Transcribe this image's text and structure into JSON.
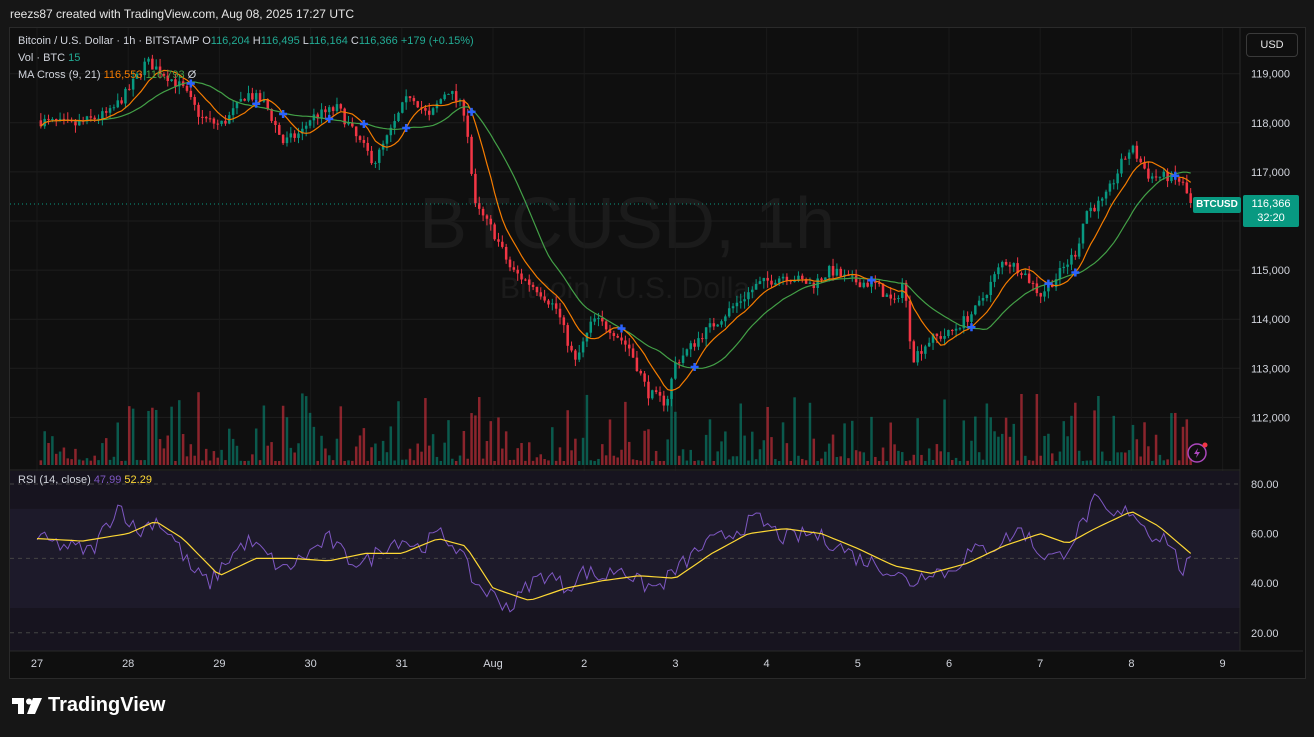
{
  "caption": "reezs87 created with TradingView.com, Aug 08, 2025 17:27 UTC",
  "legend": {
    "symbol_line": "Bitcoin / U.S. Dollar · 1h · BITSTAMP",
    "o_label": "O",
    "o_value": "116,204",
    "h_label": "H",
    "h_value": "116,495",
    "l_label": "L",
    "l_value": "116,164",
    "c_label": "C",
    "c_value": "116,366",
    "change": "+179 (+0.15%)",
    "vol_label": "Vol · BTC",
    "vol_value": "15",
    "ma_label": "MA Cross (9, 21)",
    "ma_fast": "116,553",
    "ma_slow": "116,793",
    "ma_extra": "Ø",
    "rsi_label": "RSI (14, close)",
    "rsi_value": "47.99",
    "rsi_ma_value": "52.29"
  },
  "watermark": {
    "line1": "BTCUSD, 1h",
    "line2": "Bitcoin / U.S. Dollar"
  },
  "currency_button": "USD",
  "last_price": {
    "symbol": "BTCUSD",
    "price": "116,366",
    "countdown": "32:20"
  },
  "brand": "TradingView",
  "colors": {
    "up": "#089981",
    "down": "#f23645",
    "ma_fast": "#f57c00",
    "ma_slow": "#43a047",
    "rsi": "#7e57c2",
    "rsi_ma": "#fdd835",
    "cross": "#2962ff"
  },
  "chart_data": [
    {
      "type": "candlestick",
      "title": "Bitcoin / U.S. Dollar · 1h · BITSTAMP",
      "price_axis": [
        "119,000",
        "118,000",
        "117,000",
        "116,000",
        "115,000",
        "114,000",
        "113,000",
        "112,000"
      ],
      "price_axis_values": [
        119000,
        118000,
        117000,
        116000,
        115000,
        114000,
        113000,
        112000
      ],
      "x_tick_labels": [
        "27",
        "28",
        "29",
        "30",
        "31",
        "Aug",
        "2",
        "3",
        "4",
        "5",
        "6",
        "7",
        "8",
        "9"
      ],
      "ylim": [
        111100,
        119900
      ],
      "close_path": [
        {
          "t": 0.0,
          "p": 118050
        },
        {
          "t": 0.4,
          "p": 117950
        },
        {
          "t": 0.8,
          "p": 118200
        },
        {
          "t": 1.0,
          "p": 118650
        },
        {
          "t": 1.2,
          "p": 119250
        },
        {
          "t": 1.4,
          "p": 119000
        },
        {
          "t": 1.6,
          "p": 118700
        },
        {
          "t": 1.8,
          "p": 118100
        },
        {
          "t": 2.0,
          "p": 117950
        },
        {
          "t": 2.1,
          "p": 118100
        },
        {
          "t": 2.3,
          "p": 118600
        },
        {
          "t": 2.5,
          "p": 118400
        },
        {
          "t": 2.7,
          "p": 117600
        },
        {
          "t": 2.9,
          "p": 117800
        },
        {
          "t": 3.0,
          "p": 118100
        },
        {
          "t": 3.3,
          "p": 118300
        },
        {
          "t": 3.5,
          "p": 117700
        },
        {
          "t": 3.7,
          "p": 117200
        },
        {
          "t": 3.9,
          "p": 117900
        },
        {
          "t": 4.0,
          "p": 118300
        },
        {
          "t": 4.1,
          "p": 118600
        },
        {
          "t": 4.3,
          "p": 118100
        },
        {
          "t": 4.5,
          "p": 118700
        },
        {
          "t": 4.7,
          "p": 118200
        },
        {
          "t": 4.8,
          "p": 116300
        },
        {
          "t": 5.0,
          "p": 115800
        },
        {
          "t": 5.2,
          "p": 115000
        },
        {
          "t": 5.5,
          "p": 114600
        },
        {
          "t": 5.7,
          "p": 114200
        },
        {
          "t": 5.9,
          "p": 113100
        },
        {
          "t": 6.1,
          "p": 114000
        },
        {
          "t": 6.3,
          "p": 113800
        },
        {
          "t": 6.5,
          "p": 113400
        },
        {
          "t": 6.7,
          "p": 112500
        },
        {
          "t": 6.9,
          "p": 112300
        },
        {
          "t": 7.0,
          "p": 113100
        },
        {
          "t": 7.3,
          "p": 113700
        },
        {
          "t": 7.6,
          "p": 114200
        },
        {
          "t": 7.9,
          "p": 114700
        },
        {
          "t": 8.2,
          "p": 114900
        },
        {
          "t": 8.5,
          "p": 114700
        },
        {
          "t": 8.7,
          "p": 115000
        },
        {
          "t": 8.9,
          "p": 114800
        },
        {
          "t": 9.2,
          "p": 114700
        },
        {
          "t": 9.4,
          "p": 114300
        },
        {
          "t": 9.5,
          "p": 114800
        },
        {
          "t": 9.6,
          "p": 113200
        },
        {
          "t": 9.8,
          "p": 113600
        },
        {
          "t": 10.0,
          "p": 113700
        },
        {
          "t": 10.3,
          "p": 114200
        },
        {
          "t": 10.6,
          "p": 115200
        },
        {
          "t": 10.8,
          "p": 115000
        },
        {
          "t": 11.0,
          "p": 114500
        },
        {
          "t": 11.2,
          "p": 114900
        },
        {
          "t": 11.4,
          "p": 115400
        },
        {
          "t": 11.5,
          "p": 116200
        },
        {
          "t": 11.7,
          "p": 116400
        },
        {
          "t": 11.9,
          "p": 117200
        },
        {
          "t": 12.0,
          "p": 117500
        },
        {
          "t": 12.2,
          "p": 116900
        },
        {
          "t": 12.4,
          "p": 116900
        },
        {
          "t": 12.55,
          "p": 116800
        },
        {
          "t": 12.65,
          "p": 116366
        }
      ],
      "volume_series_name": "Vol · BTC"
    },
    {
      "type": "line",
      "title": "RSI (14, close)",
      "rsi_axis": [
        "80.00",
        "60.00",
        "40.00",
        "20.00"
      ],
      "rsi_axis_values": [
        80,
        60,
        40,
        20
      ],
      "ylim": [
        15,
        85
      ],
      "rsi_path": [
        {
          "t": 0.0,
          "v": 58
        },
        {
          "t": 0.3,
          "v": 55
        },
        {
          "t": 0.6,
          "v": 53
        },
        {
          "t": 0.9,
          "v": 72
        },
        {
          "t": 1.1,
          "v": 60
        },
        {
          "t": 1.3,
          "v": 66
        },
        {
          "t": 1.5,
          "v": 58
        },
        {
          "t": 1.7,
          "v": 45
        },
        {
          "t": 1.9,
          "v": 40
        },
        {
          "t": 2.1,
          "v": 50
        },
        {
          "t": 2.3,
          "v": 57
        },
        {
          "t": 2.5,
          "v": 52
        },
        {
          "t": 2.7,
          "v": 45
        },
        {
          "t": 2.9,
          "v": 50
        },
        {
          "t": 3.2,
          "v": 58
        },
        {
          "t": 3.4,
          "v": 50
        },
        {
          "t": 3.6,
          "v": 48
        },
        {
          "t": 3.8,
          "v": 55
        },
        {
          "t": 4.0,
          "v": 58
        },
        {
          "t": 4.2,
          "v": 54
        },
        {
          "t": 4.4,
          "v": 60
        },
        {
          "t": 4.6,
          "v": 55
        },
        {
          "t": 4.8,
          "v": 40
        },
        {
          "t": 5.0,
          "v": 35
        },
        {
          "t": 5.2,
          "v": 30
        },
        {
          "t": 5.4,
          "v": 40
        },
        {
          "t": 5.6,
          "v": 44
        },
        {
          "t": 5.8,
          "v": 38
        },
        {
          "t": 6.0,
          "v": 45
        },
        {
          "t": 6.2,
          "v": 42
        },
        {
          "t": 6.4,
          "v": 47
        },
        {
          "t": 6.6,
          "v": 40
        },
        {
          "t": 6.8,
          "v": 38
        },
        {
          "t": 7.0,
          "v": 45
        },
        {
          "t": 7.3,
          "v": 55
        },
        {
          "t": 7.6,
          "v": 60
        },
        {
          "t": 7.9,
          "v": 66
        },
        {
          "t": 8.2,
          "v": 58
        },
        {
          "t": 8.5,
          "v": 60
        },
        {
          "t": 8.8,
          "v": 55
        },
        {
          "t": 9.0,
          "v": 50
        },
        {
          "t": 9.2,
          "v": 48
        },
        {
          "t": 9.4,
          "v": 44
        },
        {
          "t": 9.6,
          "v": 40
        },
        {
          "t": 9.8,
          "v": 46
        },
        {
          "t": 10.0,
          "v": 44
        },
        {
          "t": 10.2,
          "v": 52
        },
        {
          "t": 10.5,
          "v": 55
        },
        {
          "t": 10.8,
          "v": 62
        },
        {
          "t": 11.0,
          "v": 52
        },
        {
          "t": 11.2,
          "v": 50
        },
        {
          "t": 11.4,
          "v": 60
        },
        {
          "t": 11.6,
          "v": 73
        },
        {
          "t": 11.8,
          "v": 66
        },
        {
          "t": 12.0,
          "v": 70
        },
        {
          "t": 12.2,
          "v": 60
        },
        {
          "t": 12.4,
          "v": 58
        },
        {
          "t": 12.55,
          "v": 45
        },
        {
          "t": 12.65,
          "v": 48
        }
      ],
      "rsi_ma_path": [
        {
          "t": 0.0,
          "v": 58
        },
        {
          "t": 0.5,
          "v": 57
        },
        {
          "t": 1.0,
          "v": 60
        },
        {
          "t": 1.3,
          "v": 65
        },
        {
          "t": 1.6,
          "v": 58
        },
        {
          "t": 2.0,
          "v": 43
        },
        {
          "t": 2.4,
          "v": 50
        },
        {
          "t": 2.8,
          "v": 50
        },
        {
          "t": 3.2,
          "v": 49
        },
        {
          "t": 3.6,
          "v": 52
        },
        {
          "t": 4.0,
          "v": 52
        },
        {
          "t": 4.4,
          "v": 58
        },
        {
          "t": 4.7,
          "v": 55
        },
        {
          "t": 5.0,
          "v": 38
        },
        {
          "t": 5.4,
          "v": 33
        },
        {
          "t": 5.8,
          "v": 38
        },
        {
          "t": 6.2,
          "v": 41
        },
        {
          "t": 6.6,
          "v": 43
        },
        {
          "t": 7.0,
          "v": 42
        },
        {
          "t": 7.4,
          "v": 52
        },
        {
          "t": 7.8,
          "v": 60
        },
        {
          "t": 8.2,
          "v": 62
        },
        {
          "t": 8.6,
          "v": 60
        },
        {
          "t": 9.0,
          "v": 54
        },
        {
          "t": 9.4,
          "v": 47
        },
        {
          "t": 9.8,
          "v": 44
        },
        {
          "t": 10.2,
          "v": 48
        },
        {
          "t": 10.6,
          "v": 55
        },
        {
          "t": 11.0,
          "v": 60
        },
        {
          "t": 11.3,
          "v": 56
        },
        {
          "t": 11.6,
          "v": 62
        },
        {
          "t": 12.0,
          "v": 69
        },
        {
          "t": 12.3,
          "v": 63
        },
        {
          "t": 12.65,
          "v": 52
        }
      ]
    }
  ]
}
